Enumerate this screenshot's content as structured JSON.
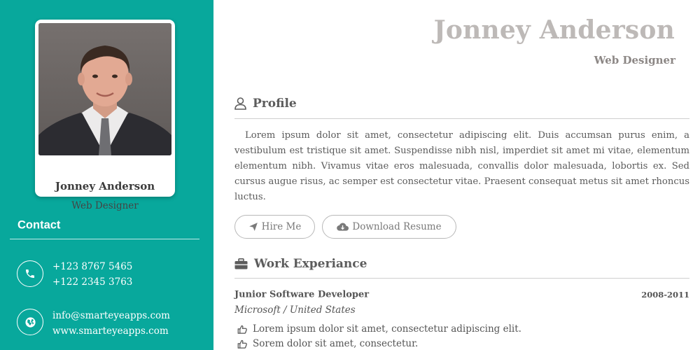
{
  "sidebar": {
    "card": {
      "name": "Jonney Anderson",
      "title": "Web Designer"
    },
    "contact_heading": "Contact",
    "contacts": [
      {
        "icon": "phone-icon",
        "lines": [
          "+123 8767 5465",
          "+122 2345 3763"
        ]
      },
      {
        "icon": "globe-icon",
        "lines": [
          "info@smarteyeapps.com",
          "www.smarteyeapps.com"
        ]
      }
    ]
  },
  "header": {
    "name": "Jonney Anderson",
    "title": "Web Designer"
  },
  "profile": {
    "heading": "Profile",
    "icon": "user-icon",
    "text": "Lorem ipsum dolor sit amet, consectetur adipiscing elit. Duis accumsan purus enim, a vestibulum est tristique sit amet. Suspendisse nibh nisl, imperdiet sit amet mi vitae, elementum elementum nibh. Vivamus vitae eros malesuada, convallis dolor malesuada, lobortis ex. Sed cursus augue risus, ac semper est consectetur vitae. Praesent consequat metus sit amet rhoncus luctus.",
    "buttons": {
      "hire": "Hire Me",
      "download": "Download Resume"
    }
  },
  "work": {
    "heading": "Work Experiance",
    "icon": "briefcase-icon",
    "jobs": [
      {
        "title": "Junior Software Developer",
        "dates": "2008-2011",
        "company": "Microsoft / United States",
        "bullets": [
          "Lorem ipsum dolor sit amet, consectetur adipiscing elit.",
          "Sorem dolor sit amet, consectetur."
        ]
      }
    ]
  },
  "colors": {
    "sidebar": "#08a89c",
    "header_name": "#bdb9b7",
    "text": "#555555"
  }
}
